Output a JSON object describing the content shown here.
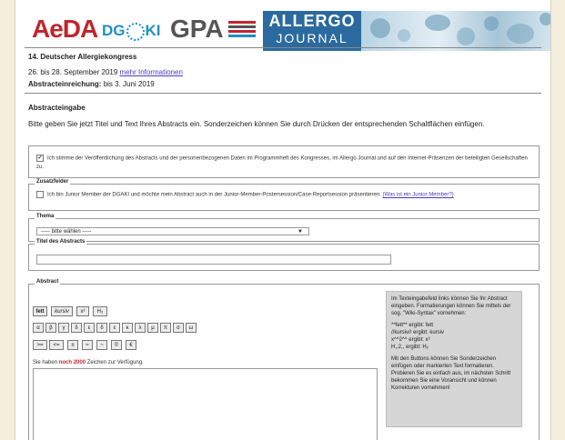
{
  "banner": {
    "logo_aeda": "AeDA",
    "logo_dgaki_left": "DG",
    "logo_dgaki_right": "KI",
    "logo_gpa": "GPA",
    "allergo_line1": "ALLERGO",
    "allergo_line2": "JOURNAL"
  },
  "congress": {
    "title": "14. Deutscher Allergiekongress",
    "dates": "26. bis 28. September 2019",
    "more_info_link": "mehr Informationen",
    "deadline_label": "Abstracteinreichung:",
    "deadline_value": "bis 3. Juni 2019"
  },
  "abstract_entry": {
    "heading": "Abstracteingabe",
    "intro": "Bitte geben Sie jetzt Titel und Text Ihres Abstracts ein. Sonderzeichen können Sie durch Drücken der entsprechenden Schaltflächen einfügen."
  },
  "consent": {
    "checked": true,
    "text": "Ich stimme der Veröffentlichung des Abstracts und der personenbezogenen Daten im Programmheft des Kongresses, im Allergo Journal und auf den Internet-Präsenzen der beteiligten Gesellschaften zu."
  },
  "additional_fields": {
    "legend": "Zusatzfelder",
    "junior_text": "Ich bin Junior Member der DGAKI und möchte mein Abstract auch in der Junior-Member-Postersession/Case-Reportsession präsentieren.",
    "junior_link": "(Was ist ein Junior Member?)"
  },
  "theme": {
    "legend": "Thema",
    "selected": "----- bitte wählen -----",
    "arrow": "▼"
  },
  "abstract_title": {
    "legend": "Titel des Abstracts",
    "value": ""
  },
  "abstract": {
    "legend": "Abstract",
    "format_buttons": [
      "fett",
      "kursiv",
      "x²",
      "H₂"
    ],
    "greek_row": [
      "α",
      "β",
      "γ",
      "δ",
      "ε",
      "δ",
      "ε",
      "κ",
      "λ",
      "μ",
      "π",
      "σ",
      "ω"
    ],
    "symbol_row": [
      ">=",
      "<=",
      "±",
      "≈",
      "~",
      "©",
      "€"
    ],
    "chars_prefix": "Sie haben",
    "chars_count": "noch 2000",
    "chars_suffix": "Zeichen zur Verfügung.",
    "text_value": ""
  },
  "help_panel": {
    "p1": "Im Texteingabefeld links können Sie Ihr Abstract eingeben. Formatierungen können Sie mittels der sog. \"Wiki-Syntax\" vornehmen:",
    "p2_l1": "**fett** ergibt: fett",
    "p2_l2": "//kursiv// ergibt: kursiv",
    "p2_l3": "x^^2^^ ergibt: x²",
    "p2_l4": "H,,2,, ergibt: H₂",
    "p3": "Mit den Buttons können Sie Sonderzeichen einfügen oder markierten Text formatieren. Probieren Sie es einfach aus, im nächsten Schritt bekommen Sie eine Voransicht und können Korrekturen vornehmen!"
  }
}
